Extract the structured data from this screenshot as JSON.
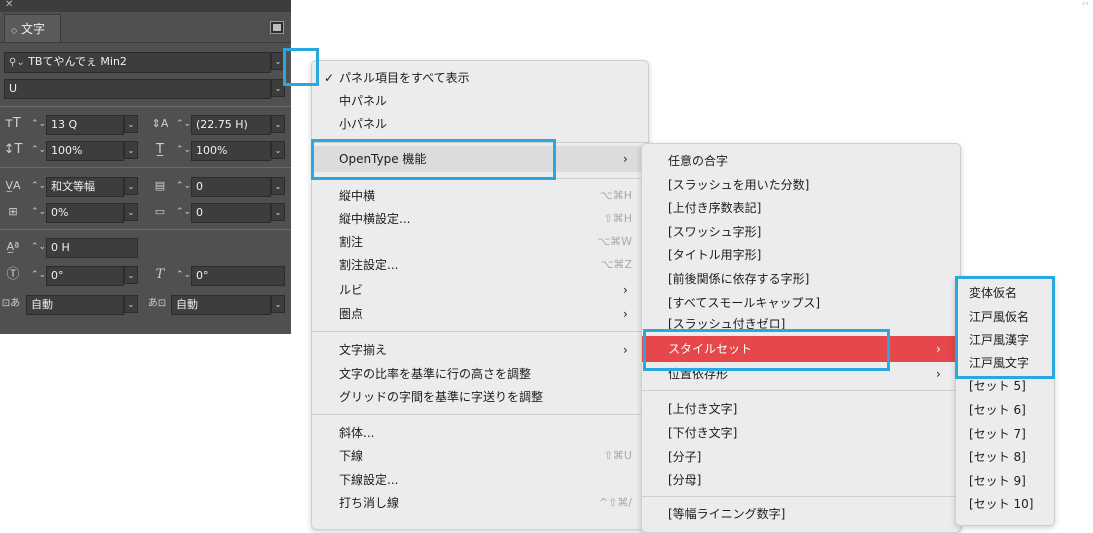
{
  "panel": {
    "title": "文字",
    "font_family": "TBてやんでぇ Min2",
    "font_style": "U",
    "size": "13 Q",
    "leading": "(22.75 H)",
    "vscale": "100%",
    "hscale": "100%",
    "kerning": "和文等幅",
    "tracking": "0",
    "tsume": "0%",
    "aki": "0",
    "baseline": "0 H",
    "rotate": "0°",
    "skew": "0°",
    "aki_before": "自動",
    "aki_after": "自動"
  },
  "menu1": {
    "items": [
      {
        "label": "パネル項目をすべて表示",
        "check": "✓"
      },
      {
        "label": "中パネル"
      },
      {
        "label": "小パネル"
      },
      {
        "label": "OpenType 機能"
      },
      {
        "label": "縦中横",
        "shortcut": "⌥⌘H"
      },
      {
        "label": "縦中横設定...",
        "shortcut": "⇧⌘H"
      },
      {
        "label": "割注",
        "shortcut": "⌥⌘W"
      },
      {
        "label": "割注設定...",
        "shortcut": "⌥⌘Z"
      },
      {
        "label": "ルビ"
      },
      {
        "label": "圏点"
      },
      {
        "label": "文字揃え"
      },
      {
        "label": "文字の比率を基準に行の高さを調整"
      },
      {
        "label": "グリッドの字間を基準に字送りを調整"
      },
      {
        "label": "斜体..."
      },
      {
        "label": "下線",
        "shortcut": "⇧⌘U"
      },
      {
        "label": "下線設定..."
      },
      {
        "label": "打ち消し線",
        "shortcut": "^⇧⌘/"
      }
    ]
  },
  "menu2": {
    "items": [
      {
        "label": "任意の合字"
      },
      {
        "label": "[スラッシュを用いた分数]"
      },
      {
        "label": "[上付き序数表記]"
      },
      {
        "label": "[スワッシュ字形]"
      },
      {
        "label": "[タイトル用字形]"
      },
      {
        "label": "[前後関係に依存する字形]"
      },
      {
        "label": "[すべてスモールキャップス]"
      },
      {
        "label": "[スラッシュ付きゼロ]"
      },
      {
        "label": "スタイルセット"
      },
      {
        "label": "位置依存形"
      },
      {
        "label": "[上付き文字]"
      },
      {
        "label": "[下付き文字]"
      },
      {
        "label": "[分子]"
      },
      {
        "label": "[分母]"
      },
      {
        "label": "[等幅ライニング数字]"
      }
    ]
  },
  "menu3": {
    "items": [
      {
        "label": "変体仮名"
      },
      {
        "label": "江戸風仮名"
      },
      {
        "label": "江戸風漢字"
      },
      {
        "label": "江戸風文字"
      },
      {
        "label": "[セット 5]"
      },
      {
        "label": "[セット 6]"
      },
      {
        "label": "[セット 7]"
      },
      {
        "label": "[セット 8]"
      },
      {
        "label": "[セット 9]"
      },
      {
        "label": "[セット 10]"
      }
    ]
  },
  "colors": {
    "highlight": "#e5474b",
    "callout": "#29a8e0",
    "panel": "#505050"
  }
}
